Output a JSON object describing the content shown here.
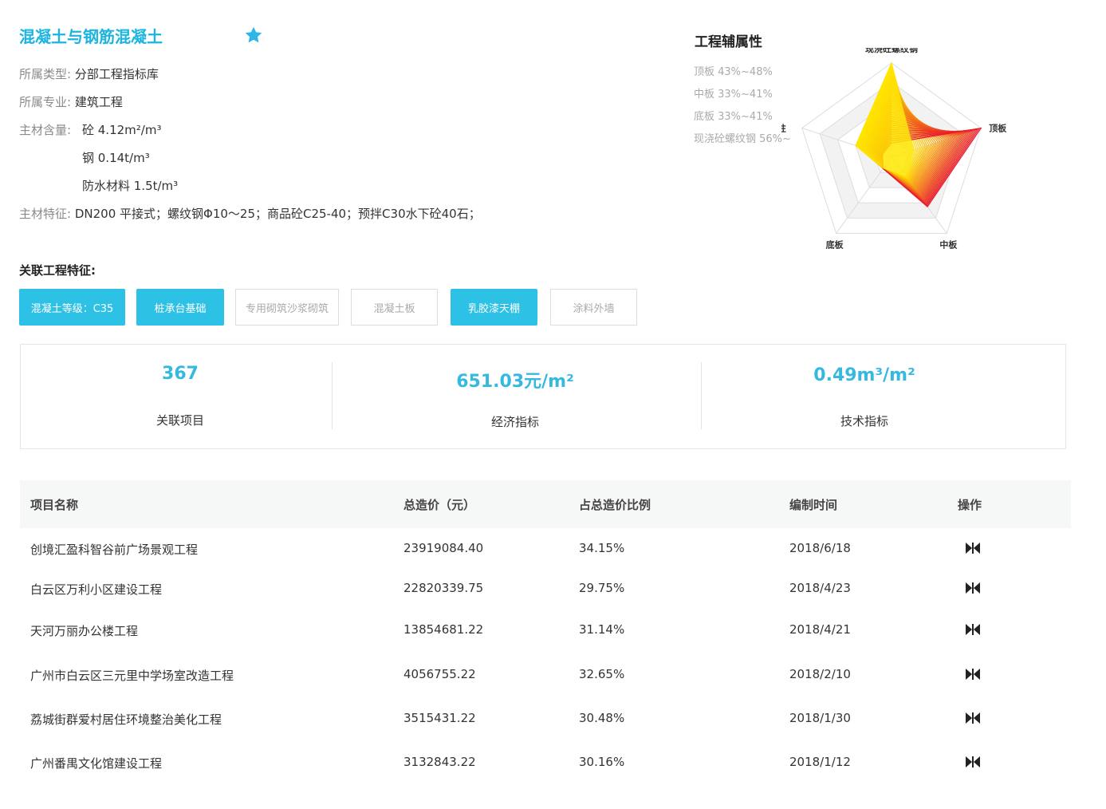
{
  "header": {
    "title": "混凝土与钢筋混凝土",
    "star_icon": "star-icon",
    "accent_color": "#1cb5e0"
  },
  "info": {
    "type_label": "所属类型:",
    "type_value": "分部工程指标库",
    "major_label": "所属专业:",
    "major_value": "建筑工程",
    "content_label": "主材含量:",
    "content_rows": [
      "砼   4.12m²/m³",
      "钢   0.14t/m³",
      "防水材料   1.5t/m³"
    ],
    "feature_label": "主材特征:",
    "feature_value": "DN200 平接式；螺纹钢Φ10～25；商品砼C25-40；预拌C30水下砼40石；"
  },
  "related": {
    "title": "关联工程特征:",
    "tags": [
      {
        "label": "混凝土等级：C35",
        "active": true
      },
      {
        "label": "桩承台基础",
        "active": true
      },
      {
        "label": "专用砌筑沙浆砌筑",
        "active": false
      },
      {
        "label": "混凝土板",
        "active": false
      },
      {
        "label": "乳胶漆天棚",
        "active": true
      },
      {
        "label": "涂料外墙",
        "active": false
      }
    ]
  },
  "stats": [
    {
      "value": "367",
      "label": "关联项目"
    },
    {
      "value": "651.03元/m²",
      "label": "经济指标"
    },
    {
      "value": "0.49m³/m²",
      "label": "技术指标"
    }
  ],
  "table": {
    "headers": [
      "项目名称",
      "总造价（元）",
      "占总造价比例",
      "编制时间",
      "操作"
    ],
    "rows": [
      [
        "创境汇盈科智谷前广场景观工程",
        "23919084.40",
        "34.15%",
        "2018/6/18"
      ],
      [
        "白云区万利小区建设工程",
        "22820339.75",
        "29.75%",
        "2018/4/23"
      ],
      [
        "天河万丽办公楼工程",
        "13854681.22",
        "31.14%",
        "2018/4/21"
      ],
      [
        "广州市白云区三元里中学场室改造工程",
        "4056755.22",
        "32.65%",
        "2018/2/10"
      ],
      [
        "荔城街群爱村居住环境整治美化工程",
        "3515431.22",
        "30.48%",
        "2018/1/30"
      ],
      [
        "广州番禺文化馆建设工程",
        "3132843.22",
        "30.16%",
        "2018/1/12"
      ]
    ],
    "action_icon": "bowtie-compare-icon"
  },
  "chart_data": {
    "type": "radar",
    "title": "工程辅属性",
    "legend": [
      "顶板 43%~48%",
      "中板 33%~41%",
      "底板 33%~41%",
      "现浇砼螺纹钢 56%~"
    ],
    "axes": [
      "现浇砼螺纹钢",
      "顶板",
      "中板",
      "底板",
      "侧柱"
    ],
    "series": [
      {
        "values": [
          1.0,
          0.25,
          0.25,
          0.15,
          0.4
        ]
      },
      {
        "values": [
          0.15,
          1.0,
          0.65,
          0.15,
          0.1
        ]
      }
    ],
    "colors": [
      "#ffe600",
      "#e8192c"
    ]
  }
}
